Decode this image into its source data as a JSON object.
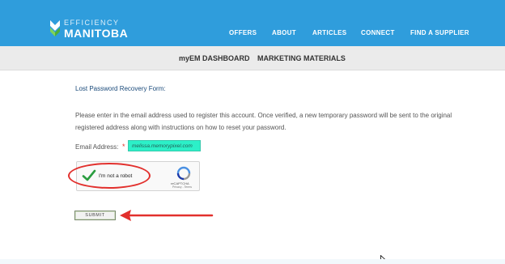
{
  "header": {
    "logo_top": "EFFICIENCY",
    "logo_bottom": "MANITOBA",
    "nav": [
      "OFFERS",
      "ABOUT",
      "ARTICLES",
      "CONNECT",
      "FIND A SUPPLIER"
    ]
  },
  "subnav": [
    "myEM DASHBOARD",
    "MARKETING MATERIALS"
  ],
  "form": {
    "title": "Lost Password Recovery Form:",
    "intro": "Please enter in the email address used to register this account. Once verified, a new temporary password will be sent to the original registered address along with instructions on how to reset your password.",
    "email_label": "Email Address:",
    "required_marker": "*",
    "email_value": "melissa.memorypixel.com",
    "captcha": {
      "label": "I'm not a robot",
      "brand": "reCAPTCHA",
      "links": "Privacy - Terms",
      "checked": true
    },
    "submit_label": "SUBMIT"
  },
  "colors": {
    "header_bg": "#2f9ddc",
    "subnav_bg": "#ebebeb",
    "email_highlight": "#2cf0c8",
    "annotation": "#e2302d"
  },
  "icons": {
    "logo": "efficiency-manitoba-logo-icon",
    "check": "checkmark-icon",
    "recaptcha": "recaptcha-logo-icon",
    "cursor": "mouse-cursor-icon"
  }
}
